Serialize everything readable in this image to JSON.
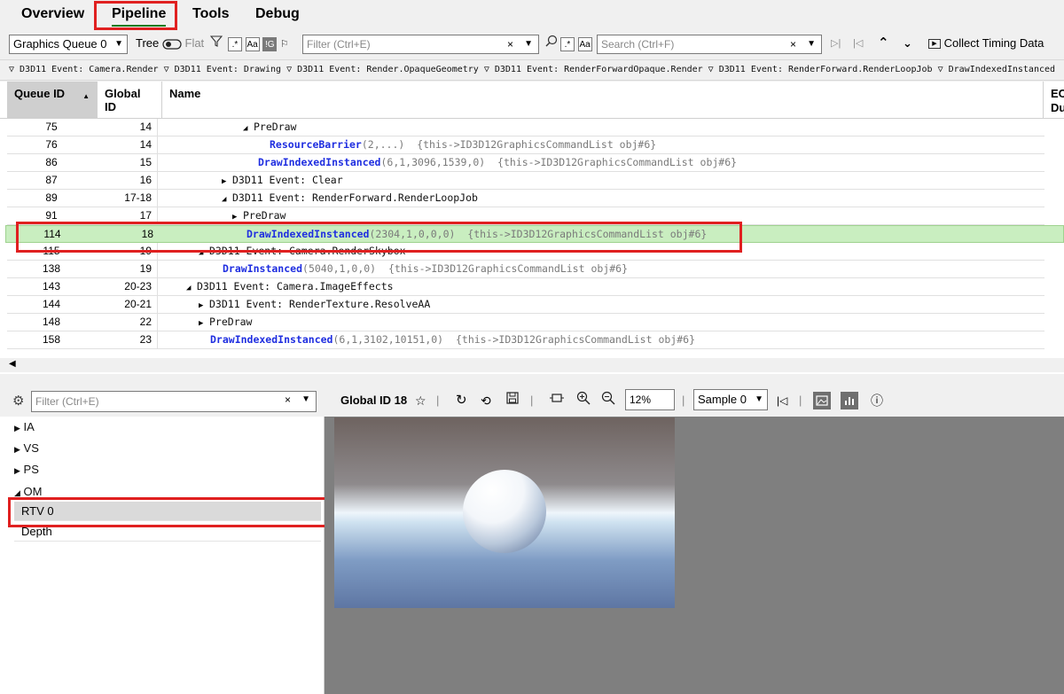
{
  "tabs": [
    {
      "label": "Overview"
    },
    {
      "label": "Pipeline"
    },
    {
      "label": "Tools"
    },
    {
      "label": "Debug"
    }
  ],
  "toolbar": {
    "queue_select": "Graphics Queue 0",
    "tree_label": "Tree",
    "flat_label": "Flat",
    "regex_label": ".*",
    "case_label": "Aa",
    "ignore_label": "!G",
    "filter_placeholder": "Filter (Ctrl+E)",
    "search_regex_label": ".*",
    "search_case_label": "Aa",
    "search_placeholder": "Search (Ctrl+F)",
    "collect_label": "Collect Timing Data"
  },
  "breadcrumb": "▽ D3D11 Event: Camera.Render ▽ D3D11 Event: Drawing ▽ D3D11 Event: Render.OpaqueGeometry ▽ D3D11 Event: RenderForwardOpaque.Render ▽ D3D11 Event: RenderForward.RenderLoopJob ▽ DrawIndexedInstanced",
  "table": {
    "columns": {
      "queue_id": "Queue ID",
      "global_id": "Global ID",
      "name": "Name",
      "extra": "EC Du"
    },
    "rows": [
      {
        "q": "75",
        "g": "14",
        "tri": "◢",
        "event": "PreDraw"
      },
      {
        "q": "76",
        "g": "14",
        "call": "ResourceBarrier",
        "args": "(2,...)",
        "obj": "{this->ID3D12GraphicsCommandList obj#6}"
      },
      {
        "q": "86",
        "g": "15",
        "call": "DrawIndexedInstanced",
        "args": "(6,1,3096,1539,0)",
        "obj": "{this->ID3D12GraphicsCommandList obj#6}"
      },
      {
        "q": "87",
        "g": "16",
        "tri": "▶",
        "event": "D3D11 Event: Clear"
      },
      {
        "q": "89",
        "g": "17-18",
        "tri": "◢",
        "event": "D3D11 Event: RenderForward.RenderLoopJob"
      },
      {
        "q": "91",
        "g": "17",
        "tri": "▶",
        "event": "PreDraw"
      },
      {
        "q": "114",
        "g": "18",
        "call": "DrawIndexedInstanced",
        "args": "(2304,1,0,0,0)",
        "obj": "{this->ID3D12GraphicsCommandList obj#6}"
      },
      {
        "q": "115",
        "g": "19",
        "tri": "◢",
        "event": "D3D11 Event: Camera.RenderSkybox"
      },
      {
        "q": "138",
        "g": "19",
        "call": "DrawInstanced",
        "args": "(5040,1,0,0)",
        "obj": "{this->ID3D12GraphicsCommandList obj#6}"
      },
      {
        "q": "143",
        "g": "20-23",
        "tri": "◢",
        "event": "D3D11 Event: Camera.ImageEffects"
      },
      {
        "q": "144",
        "g": "20-21",
        "tri": "▶",
        "event": "D3D11 Event: RenderTexture.ResolveAA"
      },
      {
        "q": "148",
        "g": "22",
        "tri": "▶",
        "event": "PreDraw"
      },
      {
        "q": "158",
        "g": "23",
        "call": "DrawIndexedInstanced",
        "args": "(6,1,3102,10151,0)",
        "obj": "{this->ID3D12GraphicsCommandList obj#6}"
      }
    ]
  },
  "left_panel": {
    "filter_placeholder": "Filter (Ctrl+E)",
    "items": [
      {
        "label": "IA",
        "tri": "▶"
      },
      {
        "label": "VS",
        "tri": "▶"
      },
      {
        "label": "PS",
        "tri": "▶"
      },
      {
        "label": "OM",
        "tri": "◢"
      }
    ],
    "sub_items": [
      {
        "label": "RTV 0"
      },
      {
        "label": "Depth"
      }
    ]
  },
  "right_panel": {
    "title": "Global ID 18",
    "zoom": "12%",
    "sample": "Sample 0"
  },
  "colors": {
    "selected_row": "#c9eec0",
    "call_blue": "#1f2ee0",
    "highlight_red": "#e02020",
    "tab_underline": "#107c10"
  }
}
